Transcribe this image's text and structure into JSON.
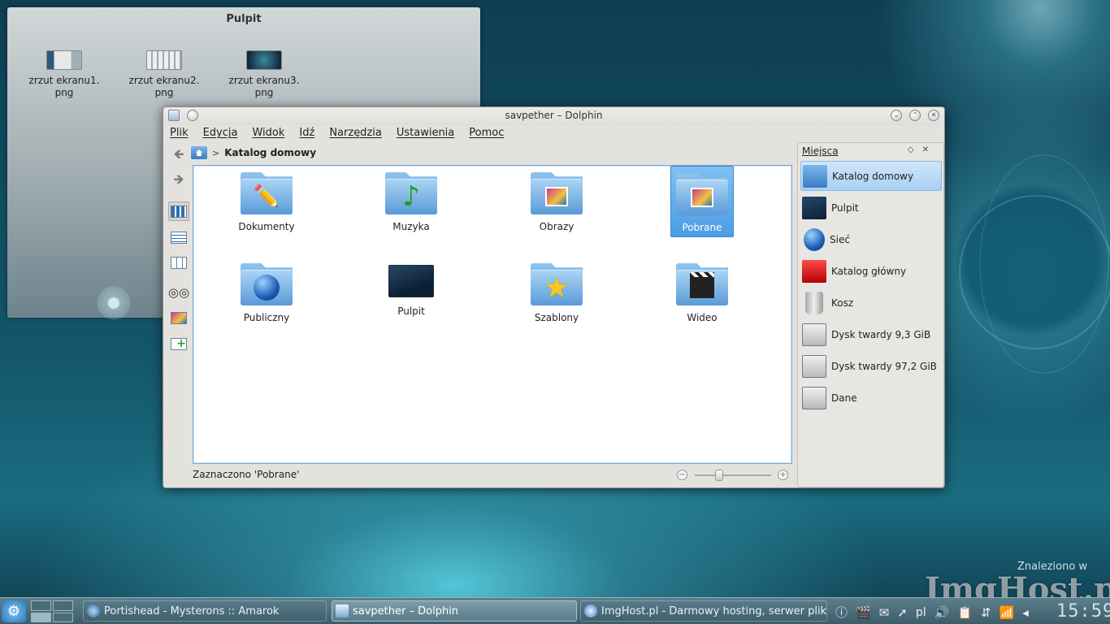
{
  "desktop": {
    "title": "Pulpit",
    "icons": [
      {
        "label": "zrzut ekranu1.\npng"
      },
      {
        "label": "zrzut ekranu2.\npng"
      },
      {
        "label": "zrzut ekranu3.\npng"
      }
    ]
  },
  "window": {
    "title": "savpether – Dolphin",
    "menu": [
      "Plik",
      "Edycja",
      "Widok",
      "Idź",
      "Narzędzia",
      "Ustawienia",
      "Pomoc"
    ],
    "breadcrumb": "Katalog domowy",
    "files": [
      {
        "name": "Dokumenty",
        "emblem": "pencil-icon"
      },
      {
        "name": "Muzyka",
        "emblem": "music-note-icon"
      },
      {
        "name": "Obrazy",
        "emblem": "picture-icon"
      },
      {
        "name": "Pobrane",
        "emblem": "picture-icon",
        "selected": true
      },
      {
        "name": "Publiczny",
        "emblem": "globe-icon"
      },
      {
        "name": "Pulpit",
        "emblem": "desktop-icon"
      },
      {
        "name": "Szablony",
        "emblem": "star-icon"
      },
      {
        "name": "Wideo",
        "emblem": "clapperboard-icon"
      }
    ],
    "status": "Zaznaczono 'Pobrane'",
    "zoom_level": 0.3
  },
  "places": {
    "title": "Miejsca",
    "items": [
      {
        "label": "Katalog domowy",
        "icon": "home-folder-icon",
        "selected": true
      },
      {
        "label": "Pulpit",
        "icon": "desktop-icon"
      },
      {
        "label": "Sieć",
        "icon": "network-globe-icon"
      },
      {
        "label": "Katalog główny",
        "icon": "root-folder-icon"
      },
      {
        "label": "Kosz",
        "icon": "trash-icon"
      },
      {
        "label": "Dysk twardy 9,3 GiB",
        "icon": "hard-disk-icon"
      },
      {
        "label": "Dysk twardy 97,2 GiB",
        "icon": "hard-disk-icon"
      },
      {
        "label": "Dane",
        "icon": "hard-disk-icon"
      }
    ]
  },
  "taskbar": {
    "tasks": [
      {
        "label": "Portishead - Mysterons  ::  Amarok"
      },
      {
        "label": "savpether – Dolphin",
        "active": true
      },
      {
        "label": "ImgHost.pl - Darmowy hosting, serwer plików..."
      }
    ],
    "keyboard_layout": "pl",
    "clock": "15:59"
  },
  "watermark": {
    "found_text": "Znaleziono w",
    "site": "ImgHost.pl"
  },
  "colors": {
    "selection": "#4b9de4",
    "folder": "#5a9ad8",
    "taskbar": "#3b5c69"
  }
}
